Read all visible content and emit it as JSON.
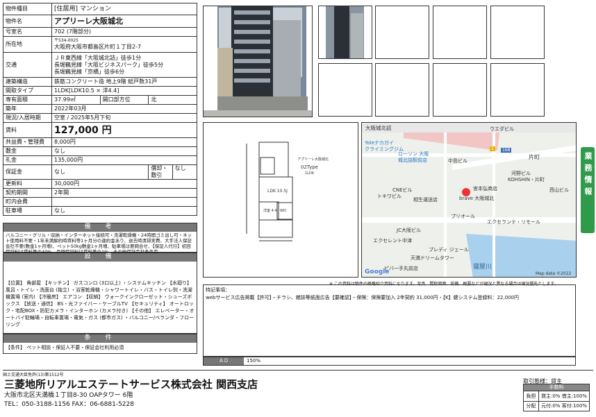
{
  "property": {
    "rows": [
      {
        "k": "物件種目",
        "v": "[住居用] マンション"
      },
      {
        "k": "物件名",
        "v": "アプリーレ大阪城北"
      },
      {
        "k": "号室名",
        "v": "702 (7階部分)"
      },
      {
        "k": "所在地",
        "zip": "〒534-0025",
        "v": "大阪府大阪市都島区片町１丁目2-7"
      },
      {
        "k": "交通",
        "lines": [
          "ＪＲ東西線「大阪城北詰」徒歩1分",
          "長堀鶴見線「大阪ビジネスパーク」徒歩5分",
          "長堀鶴見線「京橋」徒歩6分"
        ]
      },
      {
        "k": "建築構造",
        "v": "鉄筋コンクリート造 地上9階 総戸数31戸"
      },
      {
        "k": "間取タイプ",
        "v": "1LDK[LDK10.5 × 洋4.4]"
      },
      {
        "k": "専有面積",
        "v": "37.99㎡",
        "k2": "開口部方位",
        "v2": "北"
      },
      {
        "k": "築年",
        "v": "2022年03月"
      },
      {
        "k": "現況/入居時期",
        "v": "空室 / 2025年5月下旬"
      },
      {
        "k": "賃料",
        "v": "127,000 円"
      },
      {
        "k": "共益費・管理費",
        "v": "8,000円"
      },
      {
        "k": "敷金",
        "v": "なし"
      },
      {
        "k": "礼金",
        "v": "135,000円"
      },
      {
        "k": "保証金",
        "v": "なし",
        "k2": "償却・敷引",
        "v2": "なし"
      },
      {
        "k": "更新料",
        "v": "30,000円"
      },
      {
        "k": "契約期間",
        "v": "2年間"
      },
      {
        "k": "町内会費",
        "v": ""
      },
      {
        "k": "駐車場",
        "v": "なし"
      }
    ]
  },
  "remarks": {
    "title": "備　考",
    "body": "バルコニー・グリル・収納・インターネット接続可・洗濯乾燥機・24時間ゴミ出し可・ネット使用料不要・1年未満解約時賃料等1ヶ月分の違約金あり、退去時清掃実費、大手法人保証会社不要(敷金1ヶ月増)、ペット50kg敷金1ヶ月増、駐車場は要問合せ、【保証人代行】初回保証料は賃料等の40%、月額保証料は賃料等の1%、その他保証会社条件有"
  },
  "facilities": {
    "title": "設　備",
    "body": "【位置】 角部屋 【キッチン】 ガスコンロ (3口以上) ・システムキッチン 【水廻り】 風呂・トイレ・洗面台 (独立) ・浴室乾燥機・シャワートイレ・バス・トイレ別・洗濯機置場 (室内) 【冷暖房】 エアコン 【収納】 ウォークインクローゼット・シューズボックス 【放送・通信】 BS・光ファイバー・ケーブルTV 【セキュリティ】 オートロック・宅配BOX・防犯カメラ・インターホン (カメラ付き) 【その他】 エレベーター・オートバイ駐輪場・自転車置場・電気・ガス (都市ガス) ・バルコニー/ベランダ・フローリング"
  },
  "conditions": {
    "title": "条　件",
    "body": "【条件】 ペット相談・保証人不要・保証会社利用必須"
  },
  "floorplan": {
    "type_name": "アプリーレ大阪城北",
    "type": "02Type",
    "layout": "1LDK",
    "ldk": "LDK 10.5J",
    "room": "洋室 4.4J",
    "wic": "WIC"
  },
  "map": {
    "labels": [
      "大阪城北詰",
      "ウエダビル",
      "Yoleナカガイ",
      "クライミングジム",
      "ローソン 大阪",
      "城北詰駅前店",
      "中島ビル",
      "片町",
      "河野ビル",
      "KOHSHIN・片町",
      "西山ビル",
      "宮本弘商店",
      "CNEビル",
      "トキワビル",
      "相生運送店",
      "brave 大阪城北",
      "プリオール",
      "エクセランテ・リモール",
      "JC大阪ビル",
      "エクセレント中津",
      "プレディ ジェール",
      "天満ドリームタワー",
      "ピバ一手丸前店",
      "寝屋川",
      "Google",
      "Map data ©2022",
      "168",
      "1"
    ]
  },
  "notice": "※ この資料は物件の概略紹介資料になります。写真、間取図面、設備、概要などが現況と異なる場合は現況優先とします。",
  "special": {
    "label": "特記事項：",
    "body": "webサービス広告掲載【許可】・チラシ、雑誌等紙面広告【要確認】・保険：保険要加入 2年契約 31,000円・【K】鍵システム登録料：22,000円"
  },
  "ad": {
    "label": "ＡＤ",
    "value": "150%"
  },
  "sidebar": "業務情報",
  "company": {
    "license": "国土交通大臣免許(13)第1512号",
    "name": "三菱地所リアルエステートサービス株式会社 関西支店",
    "address": "大阪市北区天満橋１丁目8-30 OAPタワー 6階",
    "tel": "TEL：050-3188-1156 FAX：06-6881-5228"
  },
  "fee": {
    "mode": "取引態様：貸主",
    "head": "手数料",
    "rows": [
      {
        "k": "負担",
        "v": "貸主:0% 借主:100%"
      },
      {
        "k": "分配",
        "v": "元付:0% 客付:100%"
      }
    ]
  }
}
